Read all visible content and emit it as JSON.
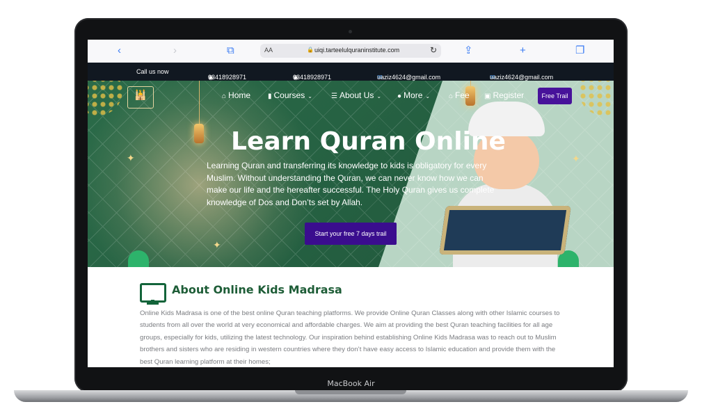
{
  "device": {
    "label": "MacBook Air"
  },
  "browser": {
    "text_size_label": "AA",
    "url": "uiqi.tarteelulquraninstitute.com",
    "icons": [
      "back-icon",
      "forward-icon",
      "book-icon",
      "reload-icon",
      "share-icon",
      "new-tab-icon",
      "tabs-icon"
    ]
  },
  "topbar": {
    "call_label": "Call us now",
    "phone1": "03418928971",
    "phone2": "03418928971",
    "email1": "uaziz4624@gmail.com",
    "email2": "uaziz4624@gmail.com"
  },
  "nav": {
    "home": "Home",
    "courses": "Courses",
    "about": "About Us",
    "more": "More",
    "fee": "Fee",
    "register": "Register",
    "free_trial": "Free Trail"
  },
  "hero": {
    "title": "Learn Quran Online",
    "text": "Learning Quran and transferring its knowledge to kids is obligatory for every Muslim. Without understanding the Quran, we can never know how we can make our life and the hereafter successful. The Holy Quran gives us complete knowledge of Dos and Don’ts set by Allah.",
    "button": "Start your free 7 days trail"
  },
  "about": {
    "title": "About Online Kids Madrasa",
    "text": "Online Kids Madrasa is one of the best online Quran teaching platforms. We provide Online Quran Classes along with other Islamic courses to students from all over the world at very economical and affordable charges. We aim at providing the best Quran teaching facilities for all age groups, especially for kids, utilizing the latest technology. Our inspiration behind establishing Online Kids Madrasa was to reach out to Muslim brothers and sisters who are residing in western countries where they don’t have easy access to Islamic education and provide them with the best Quran learning platform at their homes;"
  },
  "colors": {
    "accent": "#47129a",
    "dark_green": "#1e5d37",
    "topbar": "#111821"
  }
}
